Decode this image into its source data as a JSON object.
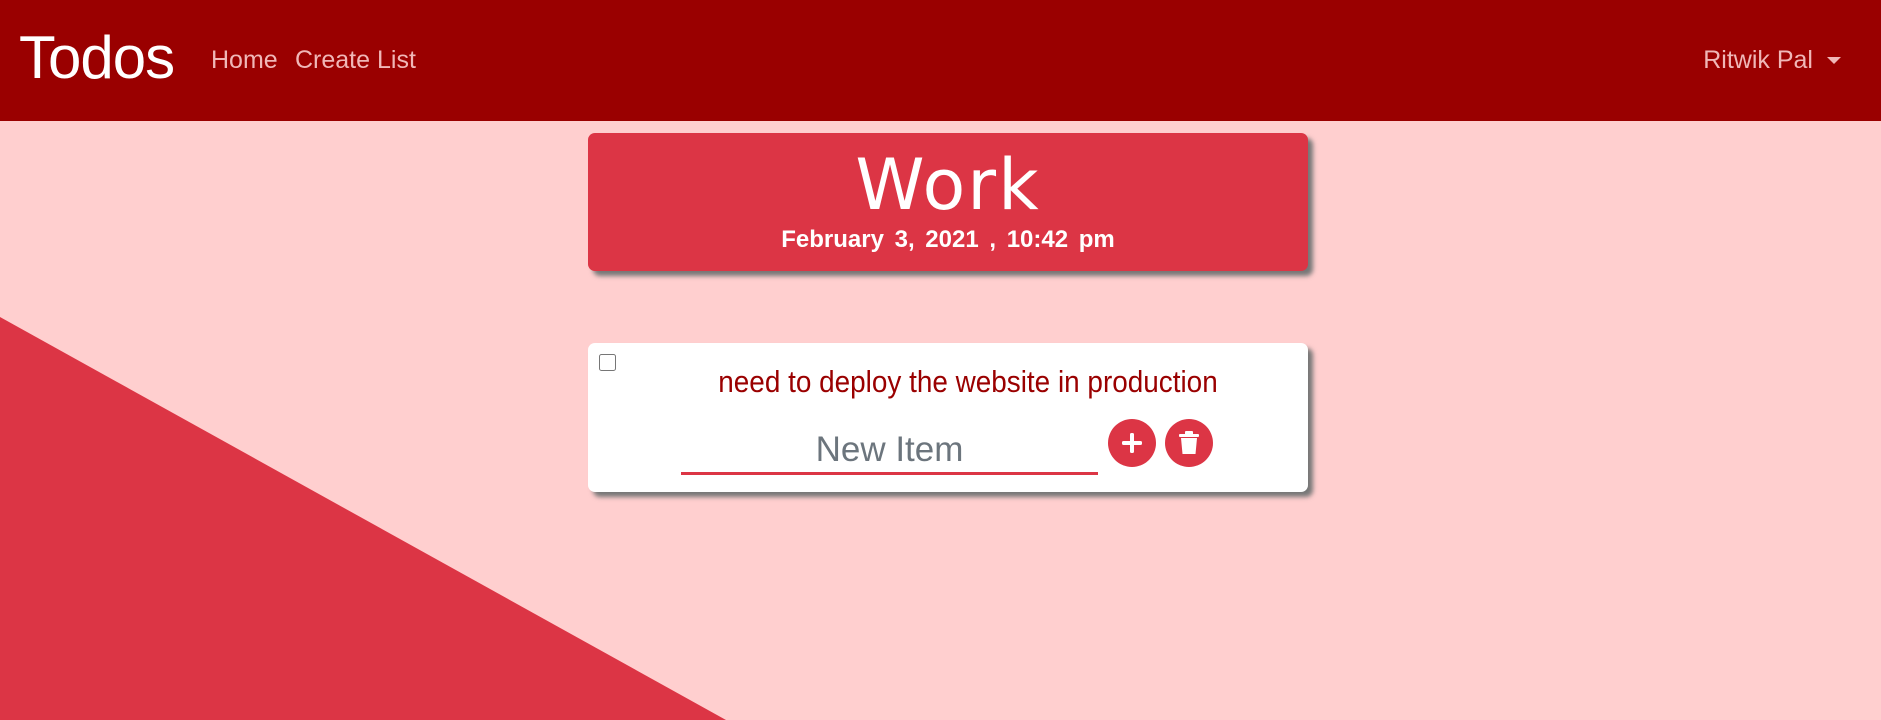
{
  "navbar": {
    "brand": "Todos",
    "links": [
      "Home",
      "Create List"
    ],
    "user": "Ritwik Pal",
    "background_color": "#9a0000"
  },
  "list": {
    "title": "Work",
    "date": "February 3, 2021 , 10:42 pm",
    "accent_color": "#dc3545"
  },
  "items": [
    {
      "text": "need to deploy the website in production",
      "checked": false
    }
  ],
  "new_item": {
    "placeholder": "New Item",
    "add_icon": "plus-icon",
    "delete_icon": "trash-icon"
  },
  "page": {
    "background_color": "#ffcfcf",
    "triangle_color": "#dc3545"
  }
}
